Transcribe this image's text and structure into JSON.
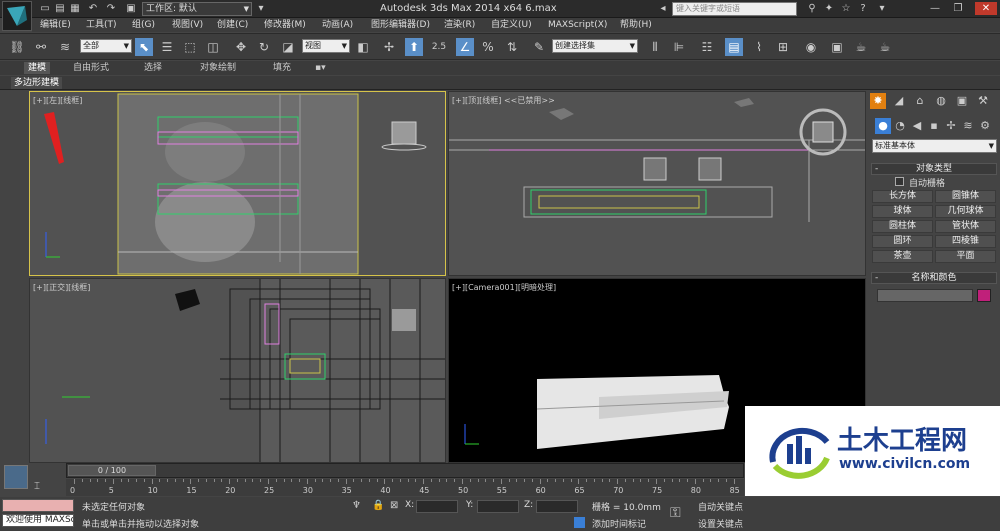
{
  "app": {
    "title": "Autodesk 3ds Max  2014 x64     6.max",
    "workspace_label": "工作区: 默认",
    "search_placeholder": "键入关键字或短语"
  },
  "menu": [
    "编辑(E)",
    "工具(T)",
    "组(G)",
    "视图(V)",
    "创建(C)",
    "修改器(M)",
    "动画(A)",
    "图形编辑器(D)",
    "渲染(R)",
    "自定义(U)",
    "MAXScript(X)",
    "帮助(H)"
  ],
  "toolbar": {
    "selection_filter": "全部",
    "reference_coord": "视图",
    "named_selection": "创建选择集",
    "snap_label": "2.5",
    "percent_snap": "%"
  },
  "ribbon": {
    "tabs": [
      "建模",
      "自由形式",
      "选择",
      "对象绘制",
      "填充"
    ],
    "active_tab": "建模",
    "sub_tab": "多边形建模"
  },
  "viewports": {
    "top_left": {
      "label": "[+][左][线框]"
    },
    "top_right": {
      "label": "[+][顶][线框] <<已禁用>>"
    },
    "bottom_left": {
      "label": "[+][正交][线框]"
    },
    "bottom_right": {
      "label": "[+][Camera001][明暗处理]"
    }
  },
  "command_panel": {
    "dropdown": "标准基本体",
    "section_object_type": "对象类型",
    "autogrid": "自动栅格",
    "objects": [
      "长方体",
      "圆锥体",
      "球体",
      "几何球体",
      "圆柱体",
      "管状体",
      "圆环",
      "四棱锥",
      "茶壶",
      "平面"
    ],
    "section_name_color": "名称和颜色",
    "object_color": "#c0207a"
  },
  "timeline": {
    "slider_label": "0 / 100",
    "ticks": [
      "0",
      "5",
      "10",
      "15",
      "20",
      "25",
      "30",
      "35",
      "40",
      "45",
      "50",
      "55",
      "60",
      "65",
      "70",
      "75",
      "80",
      "85"
    ]
  },
  "status": {
    "maxscript": "欢迎使用 MAXSc",
    "line1": "未选定任何对象",
    "line2": "单击或单击并拖动以选择对象",
    "x_label": "X:",
    "y_label": "Y:",
    "z_label": "Z:",
    "grid": "栅格 = 10.0mm",
    "add_time_tag": "添加时间标记",
    "auto_key": "自动关键点",
    "set_key": "设置关键点"
  },
  "watermark": {
    "title": "土木工程网",
    "url": "www.civilcn.com"
  }
}
